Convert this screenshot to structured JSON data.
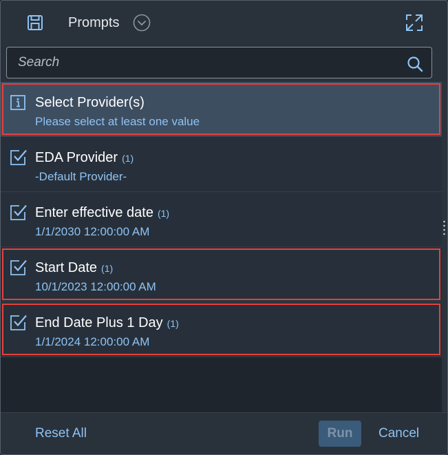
{
  "header": {
    "title": "Prompts",
    "icons": {
      "save": "save-icon",
      "collapse": "chevron-down-circle-icon",
      "expand": "expand-icon"
    }
  },
  "search": {
    "placeholder": "Search",
    "value": "",
    "icon": "search-icon"
  },
  "prompts": [
    {
      "name": "Select Provider(s)",
      "count": "",
      "value": "Please select at least one value",
      "icon": "info-icon",
      "selected": true,
      "highlighted": true
    },
    {
      "name": "EDA Provider",
      "count": "(1)",
      "value": "-Default Provider-",
      "icon": "checkbox-checked-icon",
      "selected": false,
      "highlighted": false
    },
    {
      "name": "Enter effective date",
      "count": "(1)",
      "value": "1/1/2030 12:00:00 AM",
      "icon": "checkbox-checked-icon",
      "selected": false,
      "highlighted": false
    },
    {
      "name": "Start Date",
      "count": "(1)",
      "value": "10/1/2023 12:00:00 AM",
      "icon": "checkbox-checked-icon",
      "selected": false,
      "highlighted": true
    },
    {
      "name": "End Date Plus 1 Day",
      "count": "(1)",
      "value": "1/1/2024 12:00:00 AM",
      "icon": "checkbox-checked-icon",
      "selected": false,
      "highlighted": true
    }
  ],
  "footer": {
    "reset_label": "Reset All",
    "run_label": "Run",
    "cancel_label": "Cancel"
  },
  "colors": {
    "accent": "#8ec3f5",
    "highlight": "#e8403d",
    "selected_bg": "#3d4e61",
    "run_disabled_bg": "#3a5b7a"
  }
}
